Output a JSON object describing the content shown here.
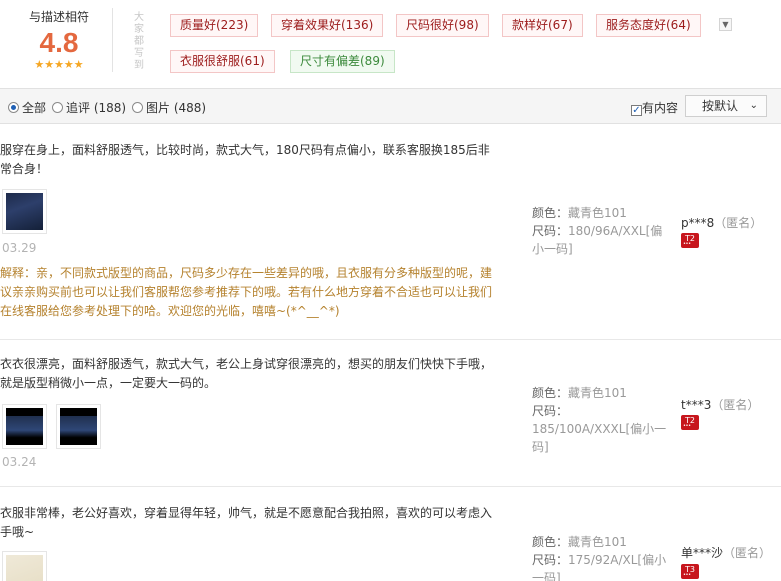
{
  "summary": {
    "label": "与描述相符",
    "score": "4.8",
    "stars": "★★★★★",
    "vertical_label": "大家都写到",
    "expand_icon": "chevron-down-icon",
    "tags": [
      {
        "text": "质量好(223)",
        "tone": "red"
      },
      {
        "text": "穿着效果好(136)",
        "tone": "red"
      },
      {
        "text": "尺码很好(98)",
        "tone": "red"
      },
      {
        "text": "款样好(67)",
        "tone": "red"
      },
      {
        "text": "服务态度好(64)",
        "tone": "red"
      },
      {
        "text": "衣服很舒服(61)",
        "tone": "red"
      },
      {
        "text": "尺寸有偏差(89)",
        "tone": "green"
      }
    ]
  },
  "filters": {
    "all": "全部",
    "followup": "追评 (188)",
    "images": "图片 (488)",
    "selected": "all",
    "has_content": "有内容",
    "has_content_checked": true,
    "sort": "按默认"
  },
  "reviews": [
    {
      "content": "服穿在身上，面料舒服透气，比较时尚，款式大气，180尺码有点偏小，联系客服换185后非常合身！",
      "date": "03.29",
      "reply": "解释：亲，不同款式版型的商品，尺码多少存在一些差异的哦，且衣服有分多种版型的呢，建议亲亲购买前也可以让我们客服帮您参考推荐下的哦。若有什么地方穿着不合适也可以让我们在线客服给您参考处理下的哈。欢迎您的光临，嘻嘻~(*^__^*)",
      "color_label": "颜色：",
      "color": "藏青色101",
      "size_label": "尺码：",
      "size": "180/96A/XXL[偏小一码]",
      "user": "p***8",
      "anon": "（匿名）",
      "badge": "T2"
    },
    {
      "content": "衣衣很漂亮，面料舒服透气，款式大气，老公上身试穿很漂亮的，想买的朋友们快快下手哦，就是版型稍微小一点，一定要大一码的。",
      "date": "03.24",
      "reply": "",
      "color_label": "颜色：",
      "color": "藏青色101",
      "size_label": "尺码：",
      "size": "185/100A/XXXL[偏小一码]",
      "user": "t***3",
      "anon": "（匿名）",
      "badge": "T2"
    },
    {
      "content": "衣服非常棒，老公好喜欢，穿着显得年轻，帅气，就是不愿意配合我拍照，喜欢的可以考虑入手哦~",
      "date": "",
      "reply": "",
      "color_label": "颜色：",
      "color": "藏青色101",
      "size_label": "尺码：",
      "size": "175/92A/XL[偏小一码]",
      "user": "单***沙",
      "anon": "（匿名）",
      "badge": "T3"
    }
  ]
}
